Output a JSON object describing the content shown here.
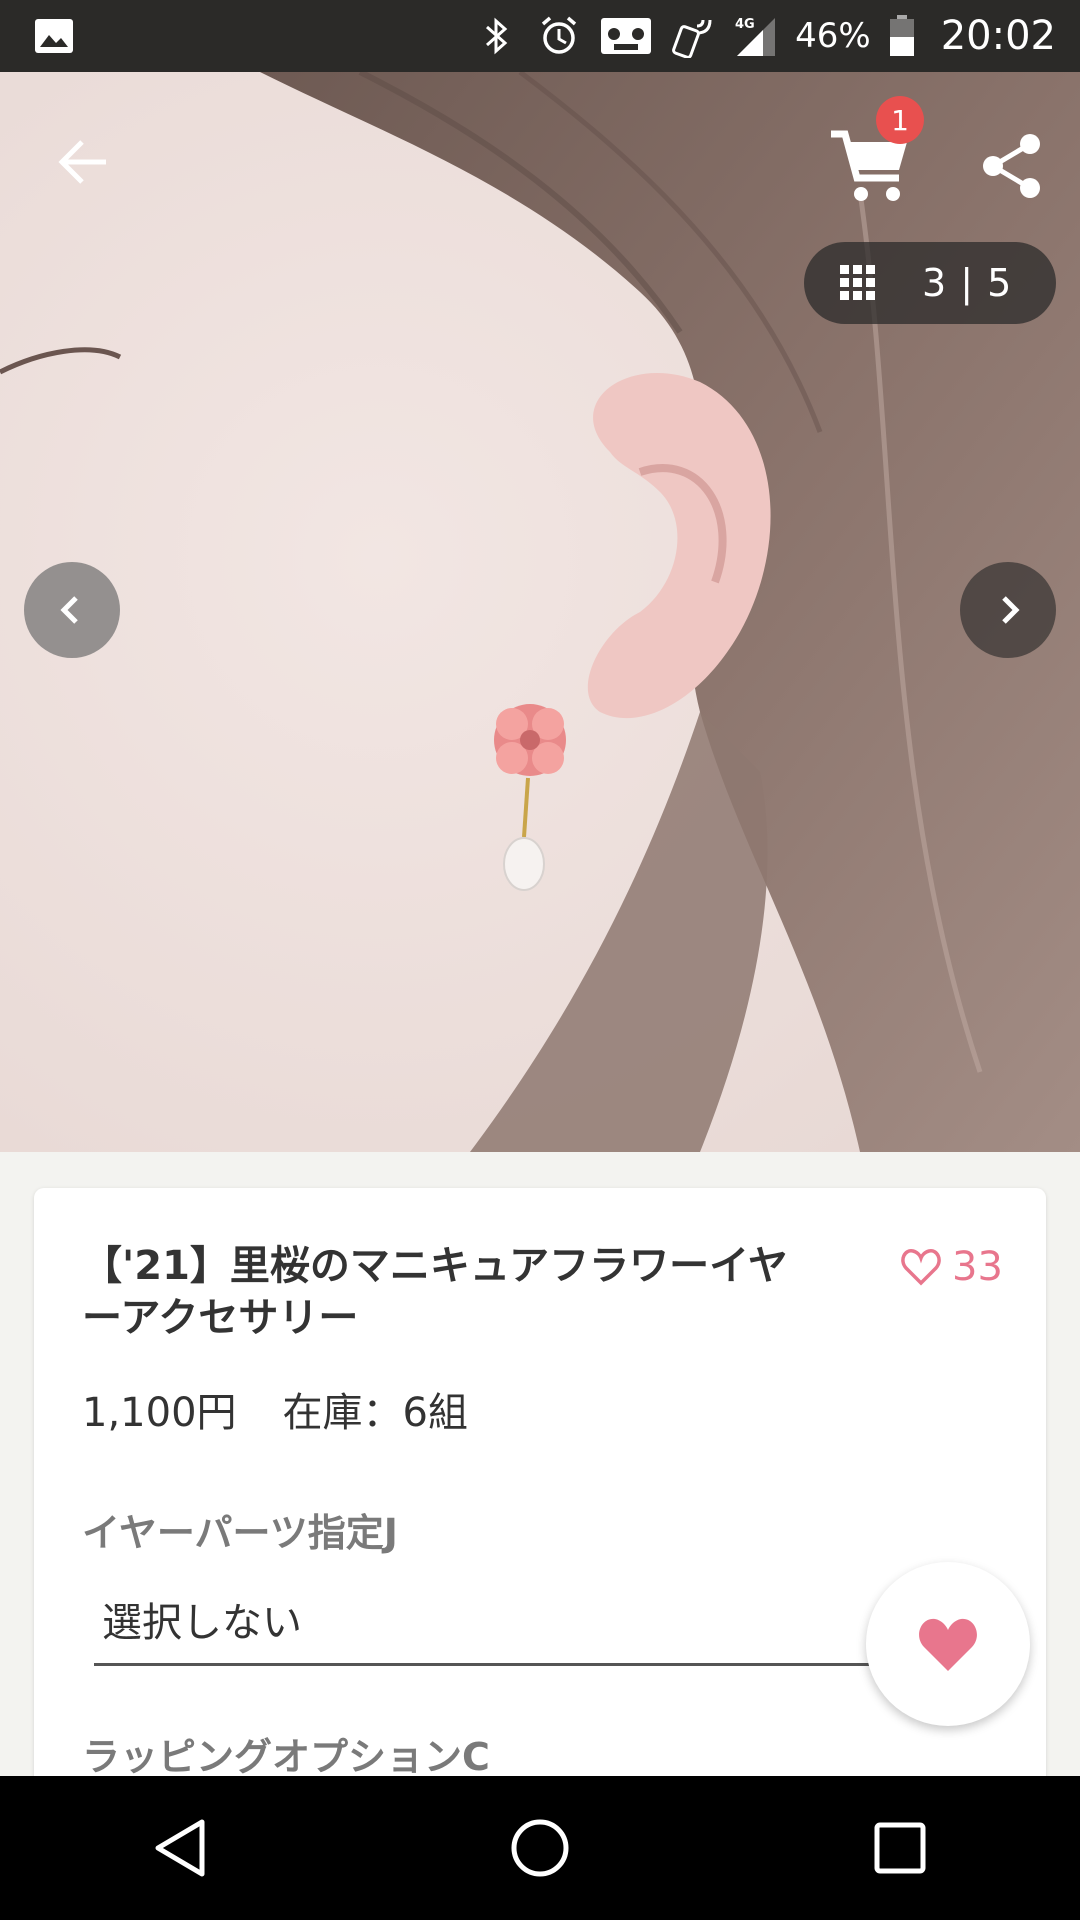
{
  "status_bar": {
    "battery": "46%",
    "time": "20:02",
    "network": "4G",
    "icons": [
      "gallery-icon",
      "bluetooth-icon",
      "alarm-icon",
      "voicemail-icon",
      "nfc-icon",
      "signal-icon",
      "battery-icon"
    ]
  },
  "header": {
    "cart_count": "1",
    "icons": [
      "back-arrow-icon",
      "cart-icon",
      "share-icon"
    ]
  },
  "gallery": {
    "counter": "3 | 5",
    "icons": [
      "grid-icon",
      "chevron-left-icon",
      "chevron-right-icon"
    ]
  },
  "product": {
    "title": "【'21】里桜のマニキュアフラワーイヤーアクセサリー",
    "like_count": "33",
    "price": "1,100円",
    "stock": "在庫：6組"
  },
  "options": {
    "ear_parts_label": "イヤーパーツ指定J",
    "ear_parts_value": "選択しない",
    "wrapping_label": "ラッピングオプションC"
  },
  "colors": {
    "accent_pink": "#e8768d",
    "badge_red": "#e8504f",
    "status_bar": "#2b2a28"
  },
  "nav_bar": {
    "icons": [
      "back-triangle-icon",
      "home-circle-icon",
      "recents-square-icon"
    ]
  }
}
